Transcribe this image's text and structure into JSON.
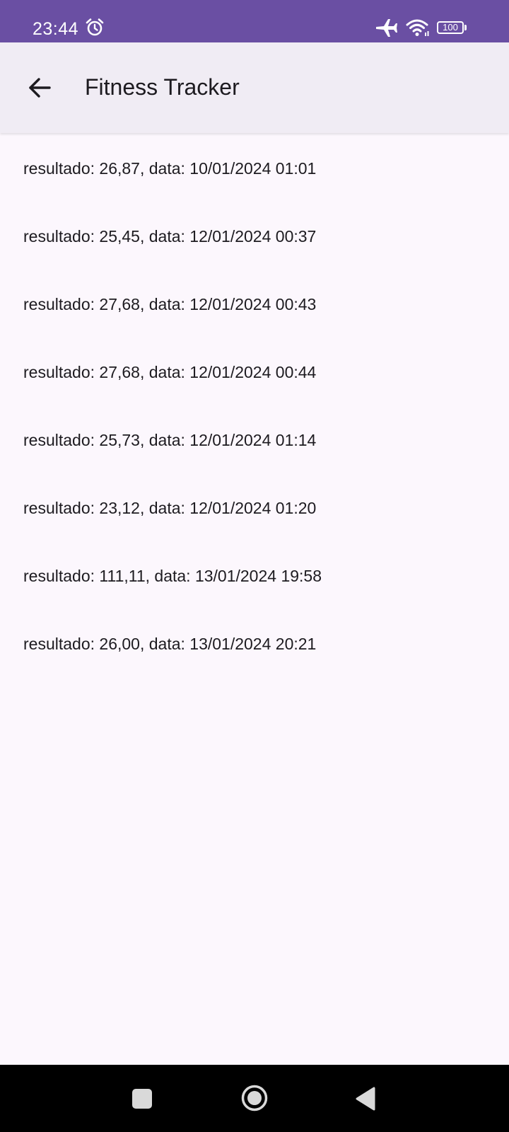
{
  "status_bar": {
    "time": "23:44",
    "battery_level": "100",
    "icons": [
      "alarm-icon",
      "airplane-icon",
      "wifi-icon",
      "battery-icon"
    ],
    "background_color": "#6a4fa3"
  },
  "app_bar": {
    "title": "Fitness Tracker",
    "back_icon": "arrow-left-icon",
    "background_color": "#f0ecf4"
  },
  "results": [
    "resultado: 26,87, data: 10/01/2024 01:01",
    "resultado: 25,45, data: 12/01/2024 00:37",
    "resultado: 27,68, data: 12/01/2024 00:43",
    "resultado: 27,68, data: 12/01/2024 00:44",
    "resultado: 25,73, data: 12/01/2024 01:14",
    "resultado: 23,12, data: 12/01/2024 01:20",
    "resultado: 111,11, data: 13/01/2024 19:58",
    "resultado: 26,00, data: 13/01/2024 20:21"
  ],
  "nav_bar": {
    "icons": [
      "recents-icon",
      "home-icon",
      "back-triangle-icon"
    ]
  }
}
